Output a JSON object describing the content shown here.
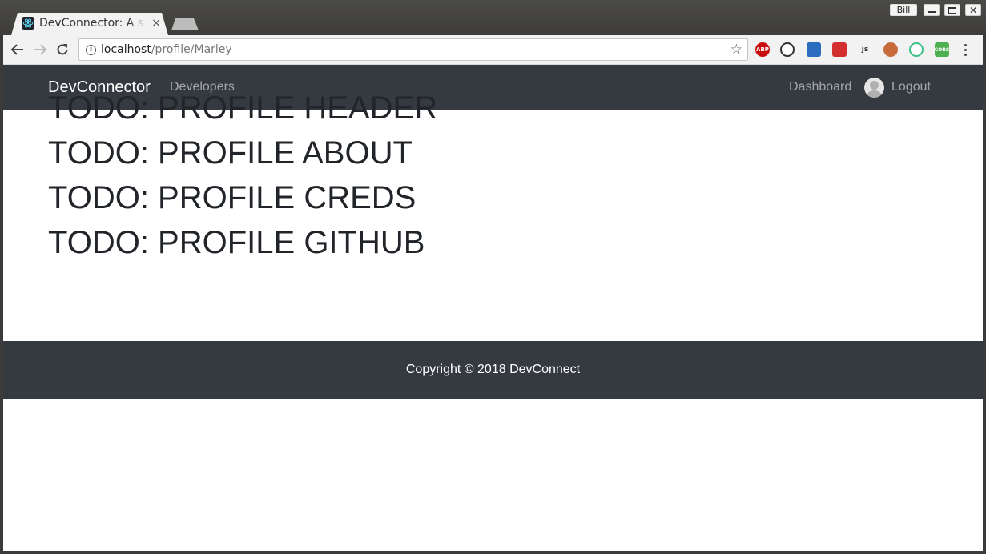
{
  "browser": {
    "tab_title": "DevConnector: A social network for developers",
    "tab_close": "×",
    "user_name": "Bill",
    "url_host": "localhost",
    "url_path": "/profile/Marley",
    "star": "☆",
    "extensions": [
      "ABP",
      "",
      "",
      "",
      "js",
      "",
      "",
      "CORS"
    ]
  },
  "navbar": {
    "brand": "DevConnector",
    "links": {
      "developers": "Developers",
      "dashboard": "Dashboard",
      "logout": "Logout"
    }
  },
  "content": {
    "todos": [
      "TODO: PROFILE HEADER",
      "TODO: PROFILE ABOUT",
      "TODO: PROFILE CREDS",
      "TODO: PROFILE GITHUB"
    ]
  },
  "footer": {
    "copyright": "Copyright © 2018 DevConnect"
  },
  "colors": {
    "navbar_bg": "#343a40",
    "link_muted": "rgba(255,255,255,0.55)",
    "text_dark": "#212529"
  }
}
